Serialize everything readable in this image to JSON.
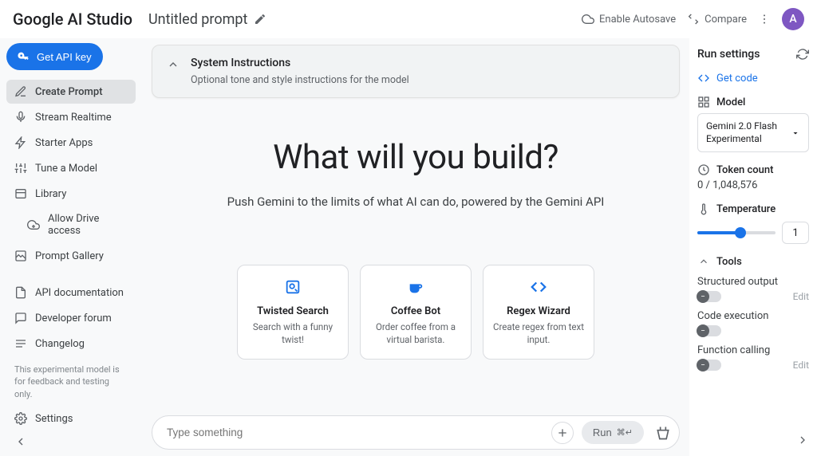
{
  "brand": "Google AI Studio",
  "title": "Untitled prompt",
  "top": {
    "autosave": "Enable Autosave",
    "compare": "Compare",
    "avatar": "A"
  },
  "sidebar": {
    "api_key": "Get API key",
    "items": [
      {
        "label": "Create Prompt"
      },
      {
        "label": "Stream Realtime"
      },
      {
        "label": "Starter Apps"
      },
      {
        "label": "Tune a Model"
      },
      {
        "label": "Library"
      },
      {
        "label": "Allow Drive access"
      },
      {
        "label": "Prompt Gallery"
      }
    ],
    "links": [
      {
        "label": "API documentation"
      },
      {
        "label": "Developer forum"
      },
      {
        "label": "Changelog"
      }
    ],
    "disclaimer": "This experimental model is for feedback and testing only.",
    "settings": "Settings"
  },
  "sys": {
    "title": "System Instructions",
    "sub": "Optional tone and style instructions for the model"
  },
  "hero": {
    "heading": "What will you build?",
    "sub": "Push Gemini to the limits of what AI can do, powered by the Gemini API"
  },
  "cards": [
    {
      "title": "Twisted Search",
      "desc": "Search with a funny twist!"
    },
    {
      "title": "Coffee Bot",
      "desc": "Order coffee from a virtual barista."
    },
    {
      "title": "Regex Wizard",
      "desc": "Create regex from text input."
    }
  ],
  "prompt": {
    "placeholder": "Type something",
    "run": "Run"
  },
  "run": {
    "title": "Run settings",
    "getcode": "Get code",
    "model_label": "Model",
    "model_value": "Gemini 2.0 Flash Experimental",
    "token_label": "Token count",
    "token_value": "0 / 1,048,576",
    "temp_label": "Temperature",
    "temp_value": "1",
    "tools_label": "Tools",
    "tools": [
      {
        "label": "Structured output",
        "edit": "Edit"
      },
      {
        "label": "Code execution",
        "edit": ""
      },
      {
        "label": "Function calling",
        "edit": "Edit"
      }
    ]
  }
}
